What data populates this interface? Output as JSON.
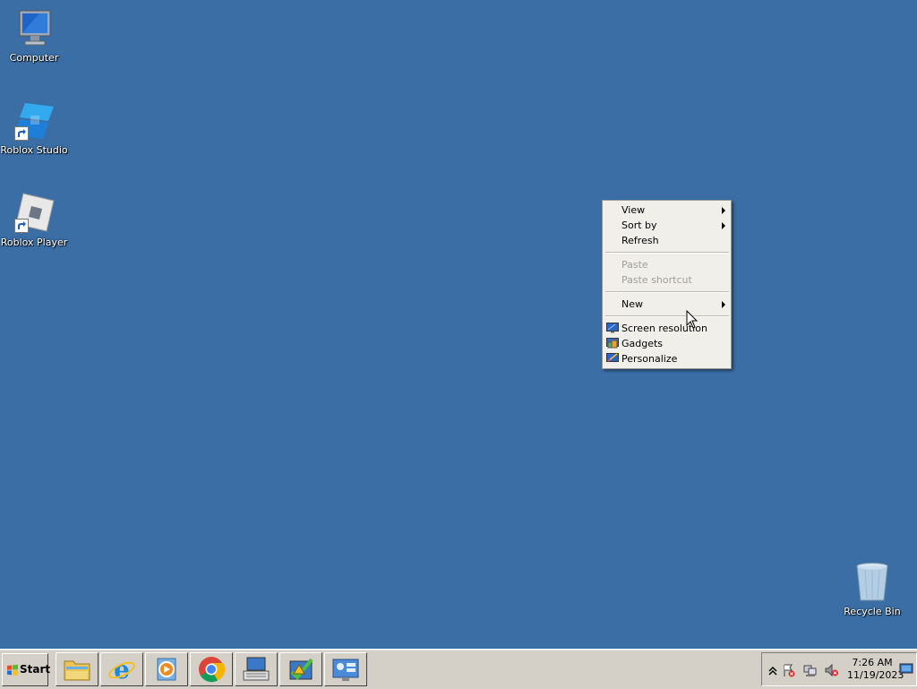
{
  "desktop": {
    "icons": [
      {
        "label": "Computer",
        "icon": "computer-icon"
      },
      {
        "label": "Roblox Studio",
        "icon": "roblox-studio-icon"
      },
      {
        "label": "Roblox Player",
        "icon": "roblox-player-icon"
      },
      {
        "label": "Recycle Bin",
        "icon": "recycle-bin-icon"
      }
    ]
  },
  "context_menu": {
    "items": [
      {
        "label": "View",
        "submenu": true
      },
      {
        "label": "Sort by",
        "submenu": true
      },
      {
        "label": "Refresh"
      },
      {
        "label": "Paste",
        "disabled": true
      },
      {
        "label": "Paste shortcut",
        "disabled": true
      },
      {
        "label": "New",
        "submenu": true
      },
      {
        "label": "Screen resolution",
        "icon": "screen-resolution-icon"
      },
      {
        "label": "Gadgets",
        "icon": "gadgets-icon"
      },
      {
        "label": "Personalize",
        "icon": "personalize-icon"
      }
    ]
  },
  "taskbar": {
    "start_label": "Start",
    "pinned": [
      "file-explorer-icon",
      "internet-explorer-icon",
      "media-player-icon",
      "chrome-icon",
      "on-screen-keyboard-icon",
      "action-center-icon",
      "control-panel-icon"
    ],
    "tray": {
      "time": "7:26 AM",
      "date": "11/19/2023"
    }
  },
  "colors": {
    "desktop": "#3a6ea5",
    "taskbar": "#d4d0c8",
    "menu": "#f0efe9"
  }
}
